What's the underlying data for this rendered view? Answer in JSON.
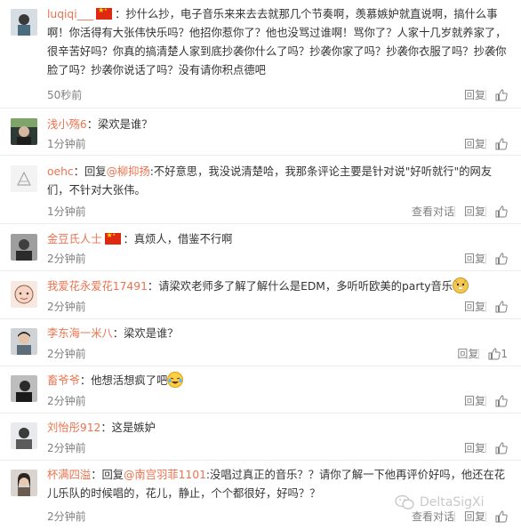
{
  "comments": [
    {
      "username": "luqiqi___",
      "text": "：抄什么抄，电子音乐来来去去就那几个节奏啊，羡慕嫉妒就直说啊，搞什么事啊！你活得有大张伟快乐吗？他招你惹你了？他也没骂过谁啊！骂你了？人家十几岁就养家了，很辛苦好吗？你真的搞清楚人家到底抄袭你什么了吗？抄袭你家了吗？抄袭你衣服了吗？抄袭你脸了吗？抄袭你说话了吗？没有请你积点德吧",
      "time": "50秒前",
      "reply": "回复"
    },
    {
      "username": "浅小殇6",
      "text": "：梁欢是谁？",
      "time": "1分钟前",
      "reply": "回复"
    },
    {
      "username": "oehc",
      "reply_prefix": "：回复",
      "reply_target": "@柳抑扬",
      "text": ":不好意思，我没说清楚哈，我那条评论主要是针对说\"好听就行\"的网友们，不针对大张伟。",
      "time": "1分钟前",
      "view_conversation": "查看对话",
      "reply": "回复"
    },
    {
      "username": "金豆氏人士",
      "text": "：真烦人，借鉴不行啊",
      "time": "2分钟前",
      "reply": "回复"
    },
    {
      "username": "我爱花永爱花17491",
      "text": "：请梁欢老师多了解了解什么是EDM，多听听欧美的party音乐",
      "time": "2分钟前",
      "reply": "回复"
    },
    {
      "username": "李东海一米八",
      "text": "：梁欢是谁？",
      "time": "2分钟前",
      "reply": "回复",
      "likes": "1"
    },
    {
      "username": "畜爷爷",
      "text": "：他想活想疯了吧",
      "time": "2分钟前",
      "reply": "回复"
    },
    {
      "username": "刘怡彤912",
      "text": "：这是嫉妒",
      "time": "2分钟前",
      "reply": "回复"
    },
    {
      "username": "杯满四溢",
      "reply_prefix": "：回复",
      "reply_target": "@南宫羽菲1101",
      "text": ":没唱过真正的音乐？？请你了解一下他再评价好吗，他还在花儿乐队的时候唱的，花儿，静止，个个都很好，好吗？？",
      "time": "2分钟前",
      "view_conversation": "查看对话",
      "reply": "回复"
    }
  ],
  "watermark": "DeltaSigXi",
  "colors": {
    "username": "#eb7350",
    "meta": "#808080",
    "divider": "#ececec"
  }
}
